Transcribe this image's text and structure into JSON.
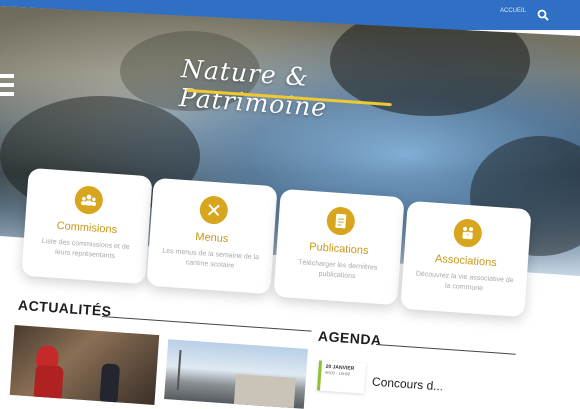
{
  "topbar": {
    "link": "ACCUEIL"
  },
  "hero": {
    "title": "Nature & Patrimoine"
  },
  "cards": [
    {
      "title": "Commisions",
      "desc": "Liste des commissions et de leurs représentants",
      "icon": "people-group-icon"
    },
    {
      "title": "Menus",
      "desc": "Les menus de la semaine de la cantine scolaire",
      "icon": "fork-knife-icon"
    },
    {
      "title": "Publications",
      "desc": "Télécharger les dernières publications",
      "icon": "document-icon"
    },
    {
      "title": "Associations",
      "desc": "Découvrez la vie associative de la commune",
      "icon": "family-icon"
    }
  ],
  "sections": {
    "news_title": "ACTUALITÉS",
    "agenda_title": "AGENDA"
  },
  "agenda": {
    "date": "20 JANVIER",
    "time": "9H00 - 18H00",
    "event": "Concours d..."
  },
  "colors": {
    "accent": "#d8a51e",
    "topbar": "#2f6fc4",
    "agenda_bar": "#8fbf32"
  }
}
